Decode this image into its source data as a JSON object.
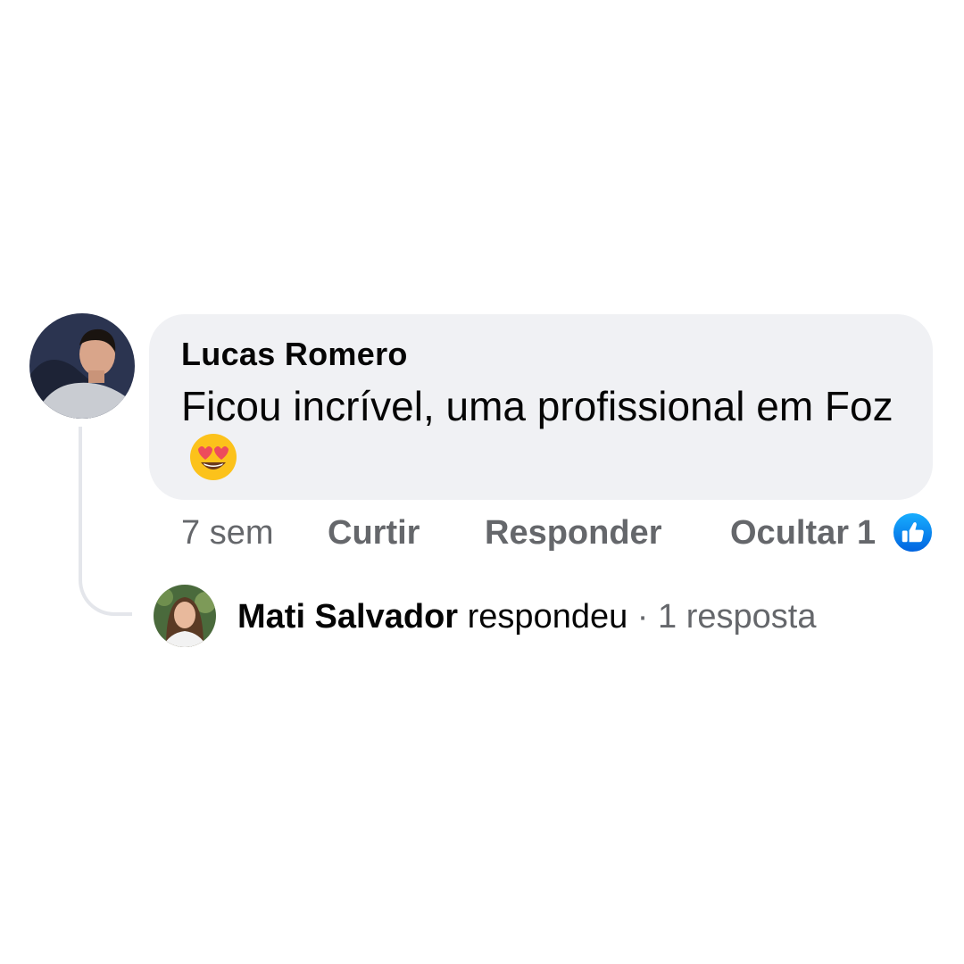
{
  "comment": {
    "author": "Lucas Romero",
    "text": "Ficou incrível, uma profissional em Foz",
    "emoji": "smiling-face-with-heart-eyes",
    "time": "7 sem",
    "like_label": "Curtir",
    "reply_label": "Responder",
    "hide_label": "Ocultar",
    "reaction_count": "1",
    "reaction_icon": "like-icon"
  },
  "reply_summary": {
    "author": "Mati Salvador",
    "verb": "respondeu",
    "separator": "·",
    "count_label": "1 resposta"
  },
  "colors": {
    "bubble_bg": "#f0f1f4",
    "meta_text": "#65676b",
    "like_blue": "#1877f2",
    "thread_line": "#e4e6eb"
  }
}
